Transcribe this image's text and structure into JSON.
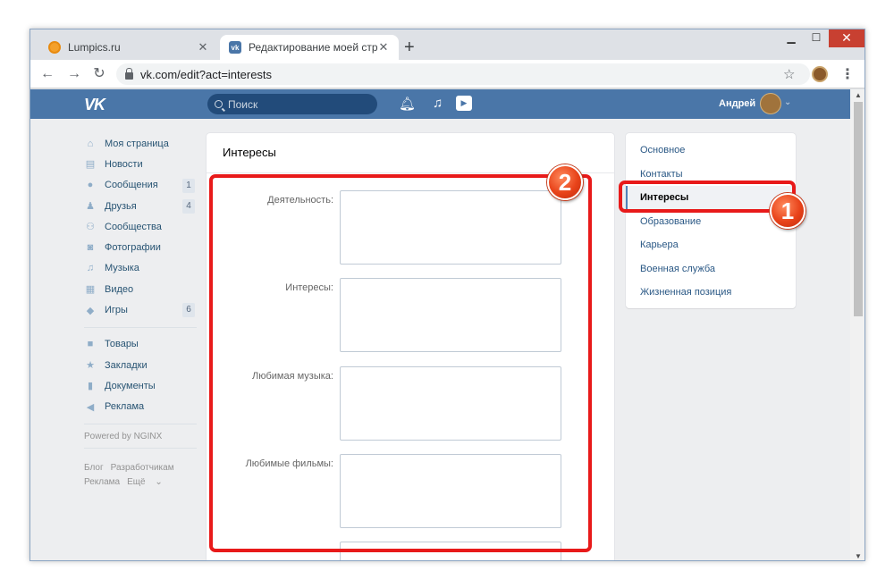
{
  "browser": {
    "tabs": [
      {
        "title": "Lumpics.ru",
        "active": false
      },
      {
        "title": "Редактирование моей страницы",
        "active": true
      }
    ],
    "url": "vk.com/edit?act=interests"
  },
  "header": {
    "logo": "VK",
    "search_placeholder": "Поиск",
    "user_name": "Андрей"
  },
  "left_menu": {
    "items": [
      {
        "label": "Моя страница",
        "icon": "home-icon",
        "count": ""
      },
      {
        "label": "Новости",
        "icon": "news-icon",
        "count": ""
      },
      {
        "label": "Сообщения",
        "icon": "messages-icon",
        "count": "1"
      },
      {
        "label": "Друзья",
        "icon": "friends-icon",
        "count": "4"
      },
      {
        "label": "Сообщества",
        "icon": "groups-icon",
        "count": ""
      },
      {
        "label": "Фотографии",
        "icon": "camera-icon",
        "count": ""
      },
      {
        "label": "Музыка",
        "icon": "music-icon",
        "count": ""
      },
      {
        "label": "Видео",
        "icon": "video-icon",
        "count": ""
      },
      {
        "label": "Игры",
        "icon": "games-icon",
        "count": "6"
      }
    ],
    "items2": [
      {
        "label": "Товары",
        "icon": "bag-icon"
      },
      {
        "label": "Закладки",
        "icon": "star-icon"
      },
      {
        "label": "Документы",
        "icon": "document-icon"
      },
      {
        "label": "Реклама",
        "icon": "megaphone-icon"
      }
    ],
    "powered": "Powered by NGINX",
    "footer": {
      "blog": "Блог",
      "developers": "Разработчикам",
      "ads": "Реклама",
      "more": "Ещё"
    }
  },
  "main": {
    "title": "Интересы",
    "fields": [
      {
        "label": "Деятельность:",
        "value": ""
      },
      {
        "label": "Интересы:",
        "value": ""
      },
      {
        "label": "Любимая музыка:",
        "value": ""
      },
      {
        "label": "Любимые фильмы:",
        "value": ""
      }
    ]
  },
  "right_menu": {
    "items": [
      {
        "label": "Основное",
        "active": false
      },
      {
        "label": "Контакты",
        "active": false
      },
      {
        "label": "Интересы",
        "active": true
      },
      {
        "label": "Образование",
        "active": false
      },
      {
        "label": "Карьера",
        "active": false
      },
      {
        "label": "Военная служба",
        "active": false
      },
      {
        "label": "Жизненная позиция",
        "active": false
      }
    ]
  },
  "annotations": {
    "badge1": "1",
    "badge2": "2",
    "color": "#e81a1a"
  },
  "colors": {
    "vk_blue": "#4a76a8",
    "link": "#2a5885",
    "background": "#edeef0"
  }
}
